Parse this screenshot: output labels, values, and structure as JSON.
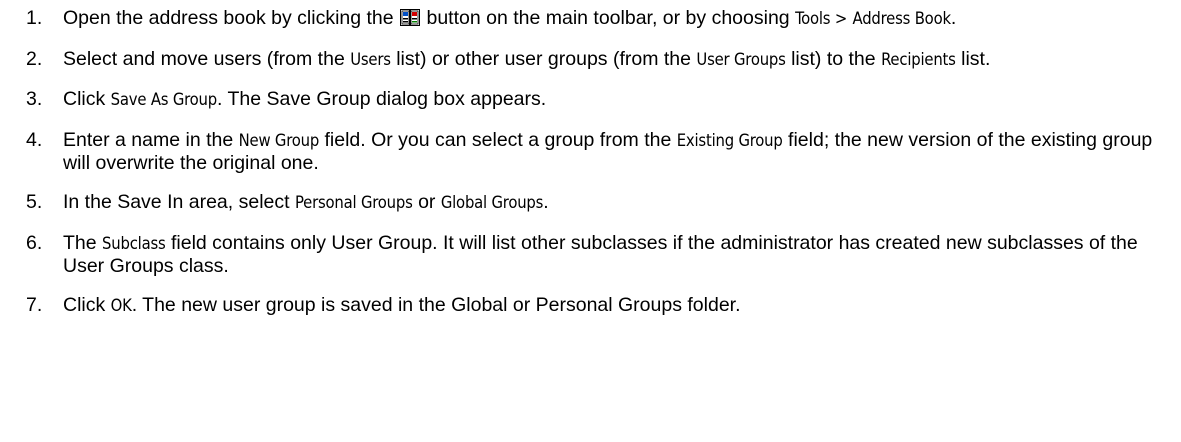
{
  "steps": [
    {
      "number": "1.",
      "parts": [
        "Open the address book by clicking the",
        "button on the main toolbar, or by choosing",
        "Tools >",
        "Address Book",
        "."
      ],
      "icon": "address-book-icon"
    },
    {
      "number": "2.",
      "parts": [
        "Select and move users (from the",
        "Users",
        "list) or other user groups (from the",
        "User Groups",
        "list) to the",
        "Recipients",
        "list."
      ]
    },
    {
      "number": "3.",
      "parts": [
        "Click",
        "Save As Group",
        ". The Save Group dialog box appears."
      ]
    },
    {
      "number": "4.",
      "parts": [
        "Enter a name in the",
        "New Group",
        "field. Or you can select a group from the",
        "Existing Group",
        "field; the new version of the existing group will overwrite the original one."
      ]
    },
    {
      "number": "5.",
      "parts": [
        "In the Save In area, select",
        "Personal Groups",
        "or",
        "Global Groups",
        "."
      ]
    },
    {
      "number": "6.",
      "parts": [
        "The",
        "Subclass",
        "field contains only User Group. It will list other subclasses if the administrator has created new subclasses of the User Groups class."
      ]
    },
    {
      "number": "7.",
      "parts": [
        "Click",
        "OK",
        ". The new user group is saved in the Global or Personal Groups folder."
      ]
    }
  ]
}
